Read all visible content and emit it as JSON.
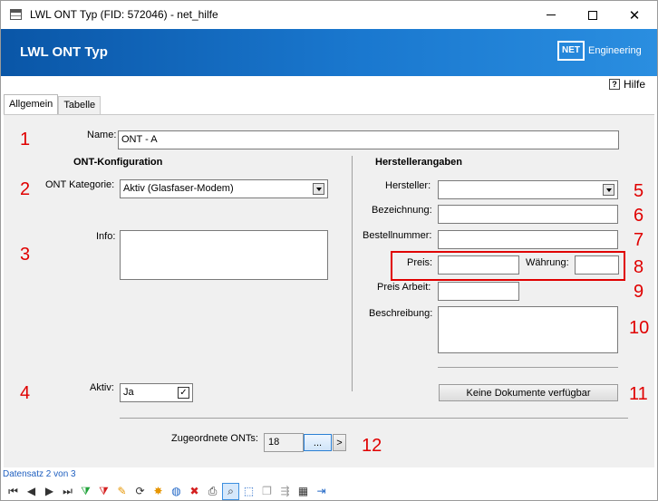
{
  "window": {
    "title": "LWL ONT Typ (FID: 572046) - net_hilfe",
    "minimize_glyph": "",
    "close_glyph": "✕"
  },
  "banner": {
    "title": "LWL ONT Typ",
    "logo_box": "NET",
    "logo_text": "Engineering"
  },
  "help": {
    "icon_glyph": "?",
    "label": "Hilfe"
  },
  "tabs": [
    {
      "label": "Allgemein",
      "active": true
    },
    {
      "label": "Tabelle",
      "active": false
    }
  ],
  "row_numbers": [
    "1",
    "2",
    "3",
    "4",
    "5",
    "6",
    "7",
    "8",
    "9",
    "10",
    "11",
    "12"
  ],
  "form": {
    "name_label": "Name:",
    "name_value": "ONT - A",
    "ont_section_title": "ONT-Konfiguration",
    "kategorie_label": "ONT Kategorie:",
    "kategorie_value": "Aktiv (Glasfaser-Modem)",
    "info_label": "Info:",
    "info_value": "",
    "aktiv_label": "Aktiv:",
    "aktiv_value": "Ja",
    "aktiv_checked_glyph": "✓",
    "hersteller_section_title": "Herstellerangaben",
    "hersteller_label": "Hersteller:",
    "hersteller_value": "",
    "bezeichnung_label": "Bezeichnung:",
    "bezeichnung_value": "",
    "bestellnummer_label": "Bestellnummer:",
    "bestellnummer_value": "",
    "preis_label": "Preis:",
    "preis_value": "",
    "waehrung_label": "Währung:",
    "waehrung_value": "",
    "preis_arbeit_label": "Preis Arbeit:",
    "preis_arbeit_value": "",
    "beschreibung_label": "Beschreibung:",
    "beschreibung_value": "",
    "dokumente_button": "Keine Dokumente verfügbar",
    "zugeordnete_label": "Zugeordnete ONTs:",
    "zugeordnete_count": "18",
    "browse_button": "...",
    "next_button": ">"
  },
  "status": {
    "text": "Datensatz 2 von 3"
  },
  "toolbar": [
    {
      "name": "first-record-icon",
      "glyph": "⏮"
    },
    {
      "name": "previous-record-icon",
      "glyph": "◀"
    },
    {
      "name": "next-record-icon",
      "glyph": "▶"
    },
    {
      "name": "last-record-icon",
      "glyph": "⏭"
    },
    {
      "name": "filter-add-icon",
      "glyph": "⧩"
    },
    {
      "name": "filter-remove-icon",
      "glyph": "⧩"
    },
    {
      "name": "edit-pencil-icon",
      "glyph": "✎"
    },
    {
      "name": "refresh-icon",
      "glyph": "⟳"
    },
    {
      "name": "new-star-icon",
      "glyph": "✸"
    },
    {
      "name": "globe-icon",
      "glyph": "◍"
    },
    {
      "name": "delete-icon",
      "glyph": "✖"
    },
    {
      "name": "print-icon",
      "glyph": "⎙"
    },
    {
      "name": "zoom-icon",
      "glyph": "⌕"
    },
    {
      "name": "select-area-icon",
      "glyph": "⬚"
    },
    {
      "name": "copy-icon",
      "glyph": "❐"
    },
    {
      "name": "move-icon",
      "glyph": "⇶"
    },
    {
      "name": "table-edit-icon",
      "glyph": "▦"
    },
    {
      "name": "exit-icon",
      "glyph": "⇥"
    }
  ]
}
